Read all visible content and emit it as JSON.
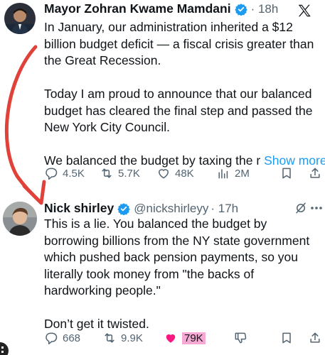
{
  "post1": {
    "author_name": "Mayor Zohran Kwame Mamdani",
    "time": "· 18h",
    "lines": [
      "In January, our administration inherited a $12",
      "billion budget deficit — a fiscal crisis greater than",
      "the Great Recession.",
      "",
      "Today I am proud to announce that our balanced",
      "budget has cleared the final step and passed the",
      "New York City Council.",
      "",
      "We balanced the budget by taxing the r"
    ],
    "show_more": "Show more",
    "replies": "4.5K",
    "reposts": "5.7K",
    "likes": "48K",
    "views": "2M",
    "icons": [
      "verified-icon",
      "x-logo-icon",
      "reply-icon",
      "repost-icon",
      "like-icon",
      "views-icon",
      "bookmark-icon",
      "share-icon"
    ]
  },
  "post2": {
    "author_name": "Nick shirley",
    "handle": "@nickshirleyy",
    "time": "· 17h",
    "lines": [
      "This is a lie. You balanced the budget by",
      "borrowing billions from the NY state government",
      "which pushed back pension payments, so you",
      "literally took money from \"the backs of",
      "hardworking people.\"",
      "",
      "Don’t get it twisted."
    ],
    "replies": "668",
    "reposts": "9.9K",
    "likes": "79K",
    "icons": [
      "verified-icon",
      "grok-icon",
      "reply-icon",
      "repost-icon",
      "like-icon-filled",
      "dislike-icon",
      "bookmark-icon",
      "share-icon"
    ]
  },
  "colors": {
    "annotation_arrow": "#e0423a",
    "verified": "#1d9bf0",
    "link": "#1d9bf0",
    "like_active": "#f91880",
    "like_highlight": "#f7a8d4",
    "muted_text": "#536471"
  }
}
